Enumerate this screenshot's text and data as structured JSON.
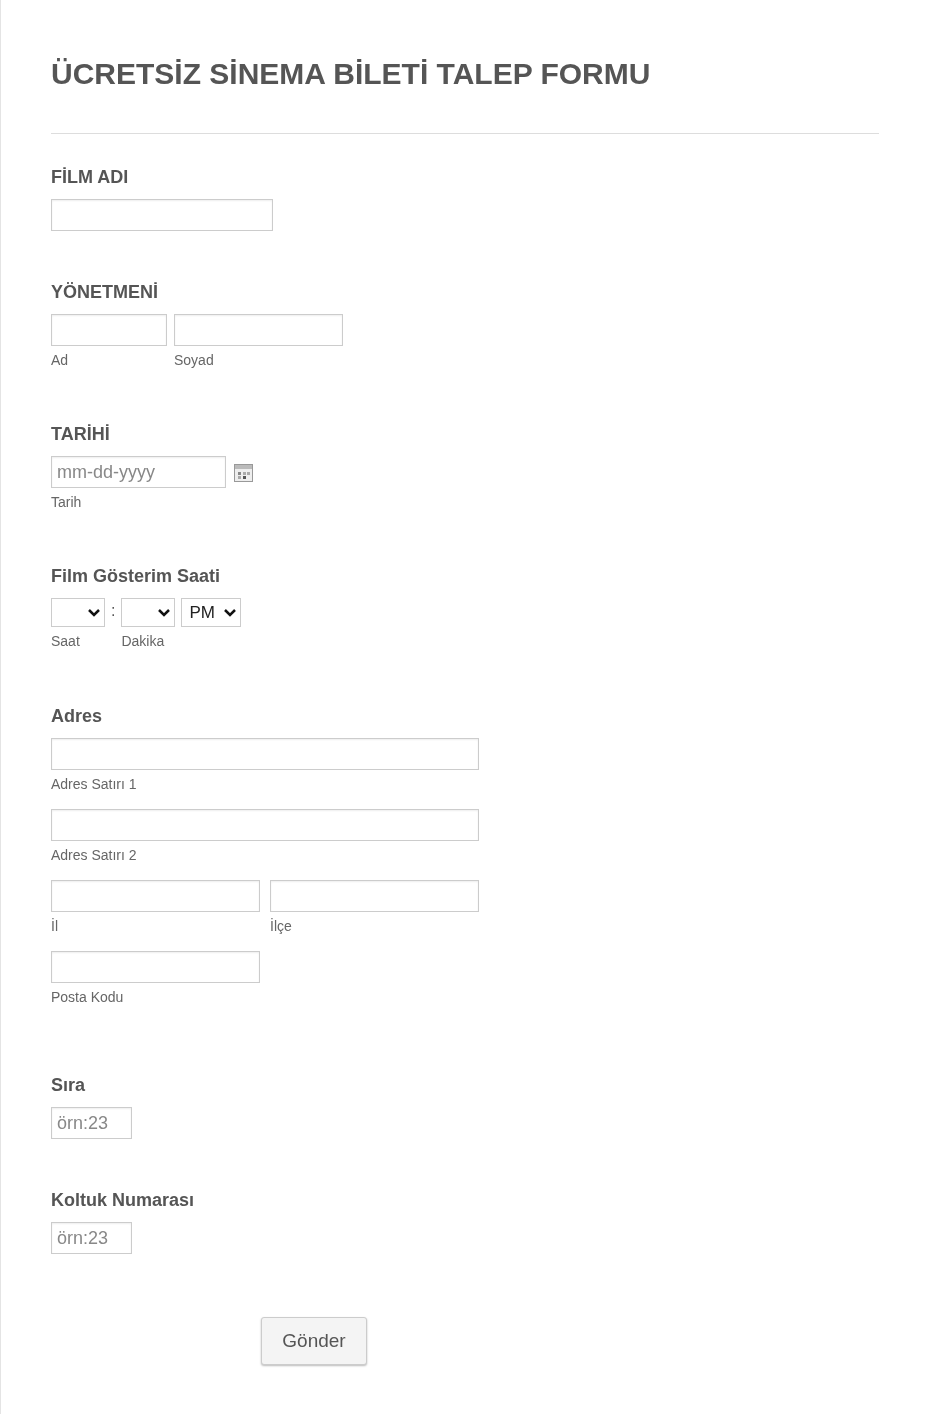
{
  "title": "ÜCRETSİZ SİNEMA BİLETİ TALEP FORMU",
  "fields": [
    {
      "kind": "text",
      "label": "FİLM ADI"
    },
    {
      "kind": "name",
      "label": "YÖNETMENİ",
      "parts": [
        "Ad",
        "Soyad"
      ]
    },
    {
      "kind": "date",
      "label": "TARİHİ",
      "placeholder": "mm-dd-yyyy",
      "sublabel": "Tarih"
    },
    {
      "kind": "time",
      "label": "Film Gösterim Saati",
      "separator": ":",
      "selects": [
        {
          "sublabel": "Saat"
        },
        {
          "sublabel": "Dakika"
        },
        {
          "value": "PM"
        }
      ]
    },
    {
      "kind": "address",
      "label": "Adres",
      "lines": [
        "Adres Satırı 1",
        "Adres Satırı 2"
      ],
      "pair": [
        "İl",
        "İlçe"
      ],
      "postal": "Posta Kodu"
    },
    {
      "kind": "number",
      "label": "Sıra",
      "placeholder": "örn:23"
    },
    {
      "kind": "number",
      "label": "Koltuk Numarası",
      "placeholder": "örn:23"
    }
  ],
  "submit": "Gönder"
}
